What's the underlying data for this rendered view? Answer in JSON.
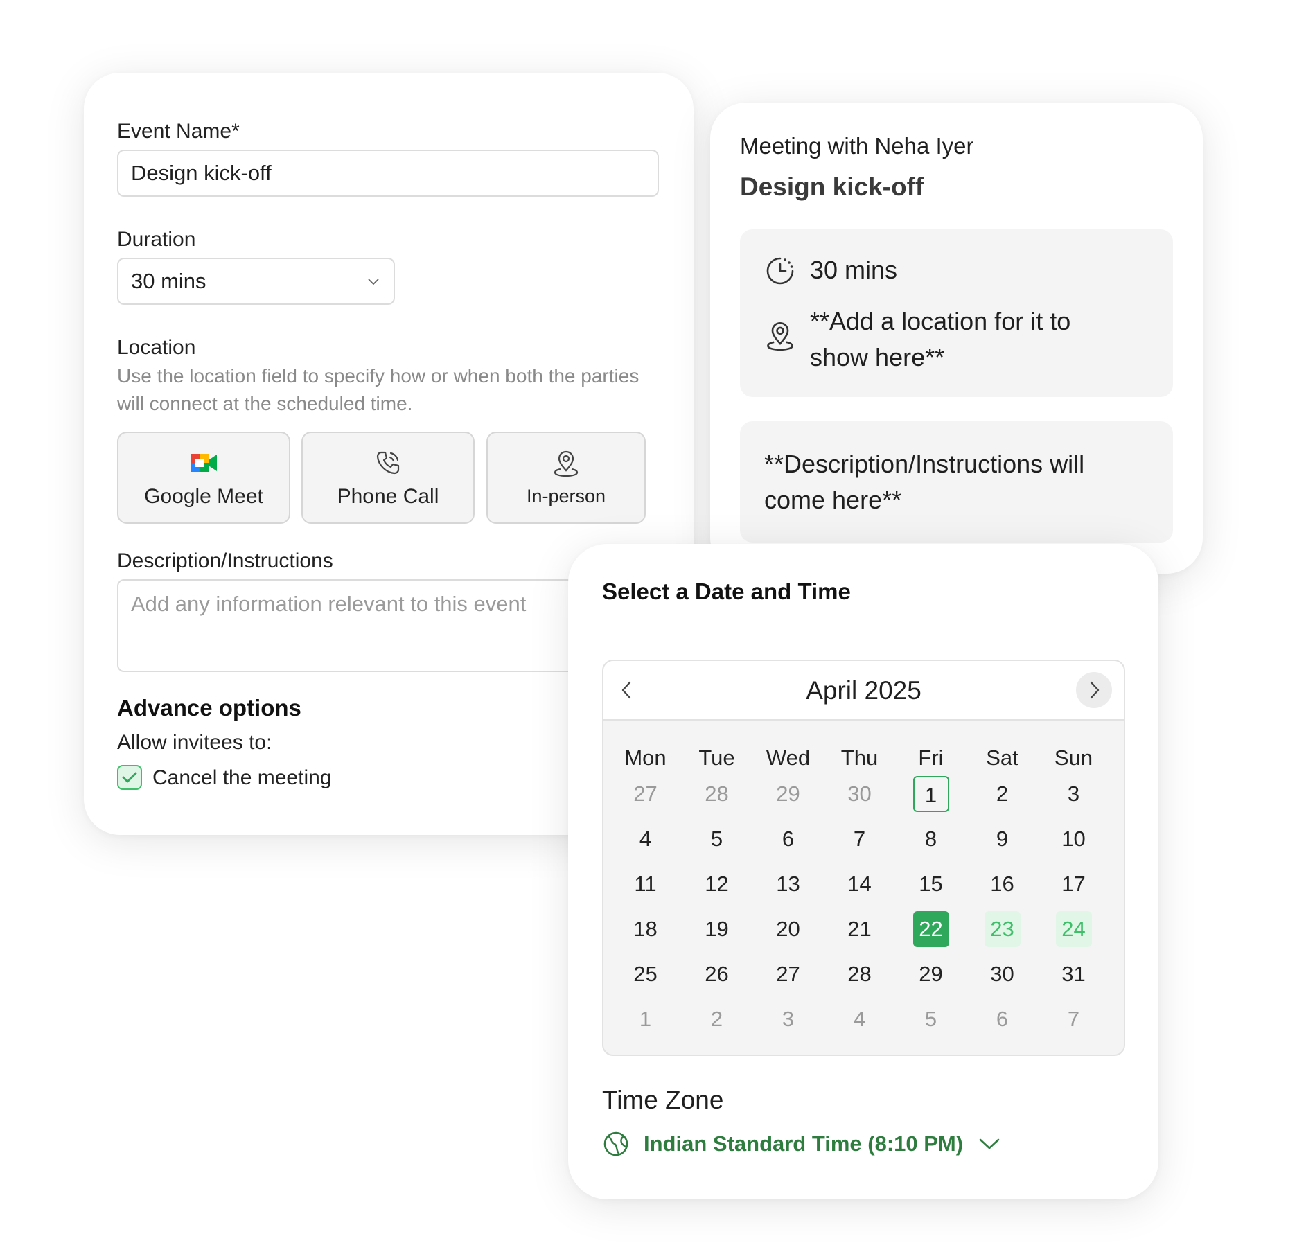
{
  "form": {
    "event_name_label": "Event Name*",
    "event_name_value": "Design kick-off",
    "duration_label": "Duration",
    "duration_value": "30 mins",
    "location_label": "Location",
    "location_help": "Use the location field to specify how or when both the parties will connect at the scheduled time.",
    "location_options": [
      "Google Meet",
      "Phone Call",
      "In-person"
    ],
    "description_label": "Description/Instructions",
    "description_placeholder": "Add any information relevant to this event",
    "advance_title": "Advance options",
    "allow_label": "Allow invitees to:",
    "cancel_label": "Cancel the meeting",
    "cancel_checked": true
  },
  "summary": {
    "meeting_with": "Meeting with Neha Iyer",
    "title": "Design kick-off",
    "duration": "30 mins",
    "location": "**Add a location for it to show here**",
    "description": "**Description/Instructions will come here**"
  },
  "calendar": {
    "heading": "Select a Date and Time",
    "month": "April",
    "year": "2025",
    "weekdays": [
      "Mon",
      "Tue",
      "Wed",
      "Thu",
      "Fri",
      "Sat",
      "Sun"
    ],
    "weeks": [
      [
        "27",
        "28",
        "29",
        "30",
        "1",
        "2",
        "3"
      ],
      [
        "4",
        "5",
        "6",
        "7",
        "8",
        "9",
        "10"
      ],
      [
        "11",
        "12",
        "13",
        "14",
        "15",
        "16",
        "17"
      ],
      [
        "18",
        "19",
        "20",
        "21",
        "22",
        "23",
        "24"
      ],
      [
        "25",
        "26",
        "27",
        "28",
        "29",
        "30",
        "31"
      ],
      [
        "1",
        "2",
        "3",
        "4",
        "5",
        "6",
        "7"
      ]
    ],
    "muted_days": [
      "0-0",
      "0-1",
      "0-2",
      "0-3",
      "5-0",
      "5-1",
      "5-2",
      "5-3",
      "5-4",
      "5-5",
      "5-6"
    ],
    "today": "1",
    "selected": "22",
    "available": [
      "23",
      "24"
    ],
    "timezone_label": "Time Zone",
    "timezone_value": "Indian Standard Time (8:10 PM)",
    "accent_color": "#2fa85b"
  }
}
